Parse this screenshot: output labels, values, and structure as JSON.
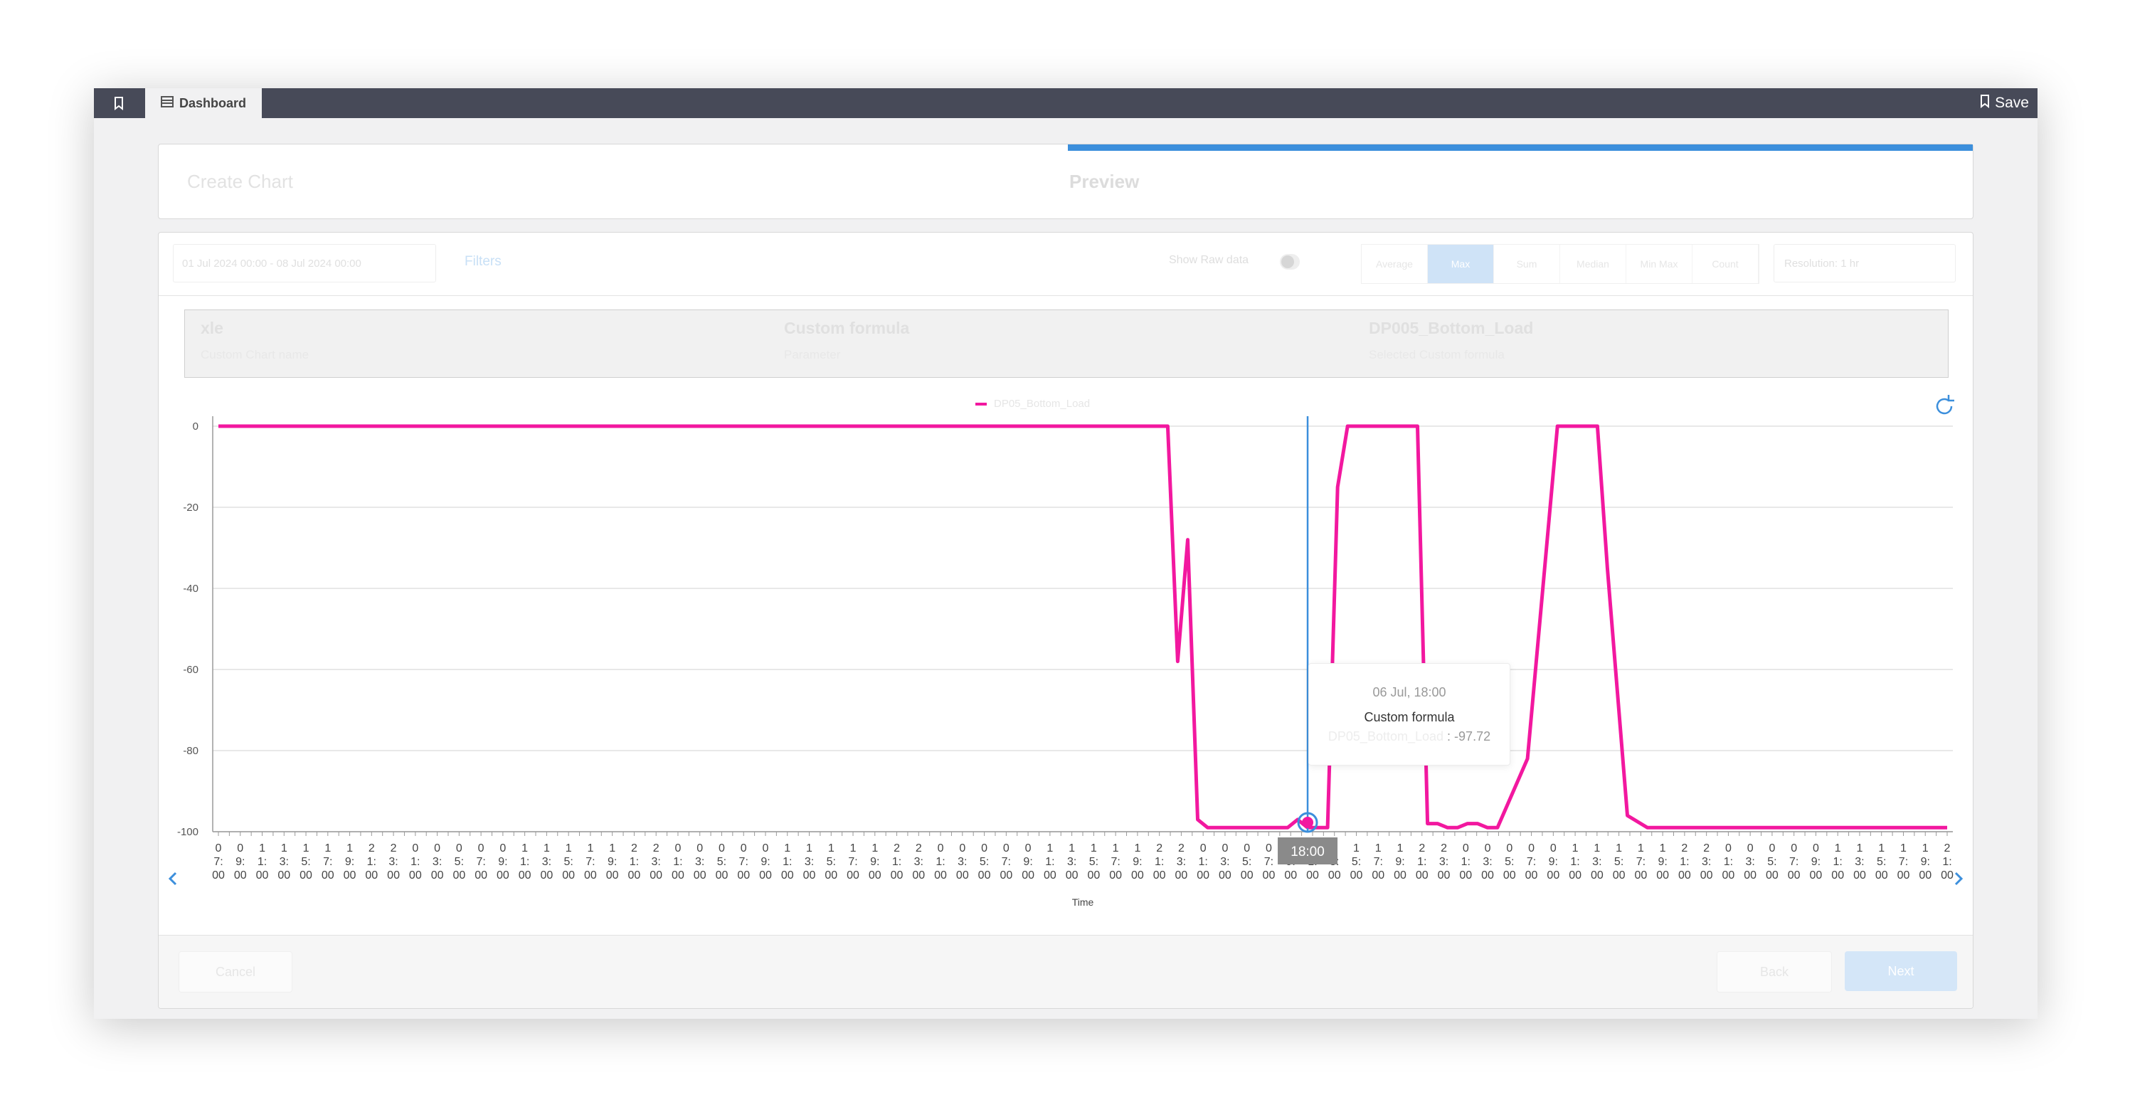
{
  "topbar": {
    "dashboard_tab": "Dashboard",
    "save_label": "Save"
  },
  "steps": {
    "step1": "Create Chart",
    "step2": "Preview"
  },
  "toolbar": {
    "date_range": "01 Jul 2024 00:00 - 08 Jul 2024 00:00",
    "filters": "Filters",
    "raw_data_label": "Show Raw data",
    "aggregations": [
      "Average",
      "Max",
      "Sum",
      "Median",
      "Min Max",
      "Count"
    ],
    "selected_aggregation": "Max",
    "resolution": "Resolution: 1 hr"
  },
  "info": [
    {
      "title": "xle",
      "subtitle": "Custom Chart name"
    },
    {
      "title": "Custom formula",
      "subtitle": "Parameter"
    },
    {
      "title": "DP005_Bottom_Load",
      "subtitle": "Selected Custom formula"
    }
  ],
  "legend": {
    "series_name": "DP05_Bottom_Load"
  },
  "tooltip": {
    "date": "06 Jul, 18:00",
    "name": "Custom formula",
    "series_label": "DP05_Bottom_Load",
    "value": "-97.72"
  },
  "crosshair_label": "18:00",
  "footer": {
    "cancel": "Cancel",
    "back": "Back",
    "next": "Next"
  },
  "chart_data": {
    "type": "line",
    "xlabel": "Time",
    "ylabel": "",
    "ylim": [
      -100,
      0
    ],
    "y_ticks": [
      0,
      -20,
      -40,
      -60,
      -80,
      -100
    ],
    "x_labels": [
      "07:00",
      "09:00",
      "11:00",
      "13:00",
      "15:00",
      "17:00",
      "19:00",
      "21:00",
      "23:00",
      "01:00",
      "03:00",
      "05:00",
      "07:00",
      "09:00",
      "11:00",
      "13:00",
      "15:00",
      "17:00",
      "19:00",
      "21:00",
      "23:00",
      "01:00",
      "03:00",
      "05:00",
      "07:00",
      "09:00",
      "11:00",
      "13:00",
      "15:00",
      "17:00",
      "19:00",
      "21:00",
      "23:00",
      "01:00",
      "03:00",
      "05:00",
      "07:00",
      "09:00",
      "11:00",
      "13:00",
      "15:00",
      "17:00",
      "19:00",
      "21:00",
      "23:00",
      "01:00",
      "03:00",
      "05:00",
      "07:00",
      "09:00",
      "11:00",
      "13:00",
      "15:00",
      "17:00",
      "19:00",
      "21:00",
      "23:00",
      "01:00",
      "03:00",
      "05:00",
      "07:00",
      "09:00",
      "11:00",
      "13:00",
      "15:00",
      "17:00",
      "19:00",
      "21:00",
      "23:00",
      "01:00",
      "03:00",
      "05:00",
      "07:00",
      "09:00",
      "11:00",
      "13:00",
      "15:00",
      "17:00",
      "19:00",
      "21:00"
    ],
    "series": [
      {
        "name": "DP05_Bottom_Load",
        "color": "#f2189f",
        "x": [
          0,
          95,
          96,
          97,
          98,
          99,
          100,
          101,
          102,
          104,
          105,
          106,
          107,
          108,
          109,
          110,
          111,
          112,
          113,
          114,
          115,
          116,
          117,
          118,
          119,
          120,
          121,
          122,
          123,
          124,
          125,
          126,
          127,
          128,
          131,
          134,
          135,
          136,
          137,
          138,
          139,
          141,
          143,
          144,
          145,
          146,
          147,
          148,
          149,
          150,
          151,
          152,
          153,
          154,
          155,
          165,
          170,
          171,
          172,
          173
        ],
        "y": [
          0,
          0,
          -58,
          -28,
          -97,
          -99,
          -99,
          -99,
          -99,
          -99,
          -99,
          -99,
          -99,
          -97,
          -99,
          -99,
          -99,
          -15,
          0,
          0,
          0,
          0,
          0,
          0,
          0,
          0,
          -98,
          -98,
          -99,
          -99,
          -98,
          -98,
          -99,
          -99,
          -82,
          0,
          0,
          0,
          0,
          0,
          -35,
          -96,
          -99,
          -99,
          -99,
          -99,
          -99,
          -99,
          -99,
          -99,
          -99,
          -99,
          -99,
          -99,
          -99,
          -99,
          -99,
          -99,
          -99,
          -99
        ]
      }
    ],
    "highlight": {
      "x_label": "18:00",
      "value": -97.72
    }
  }
}
